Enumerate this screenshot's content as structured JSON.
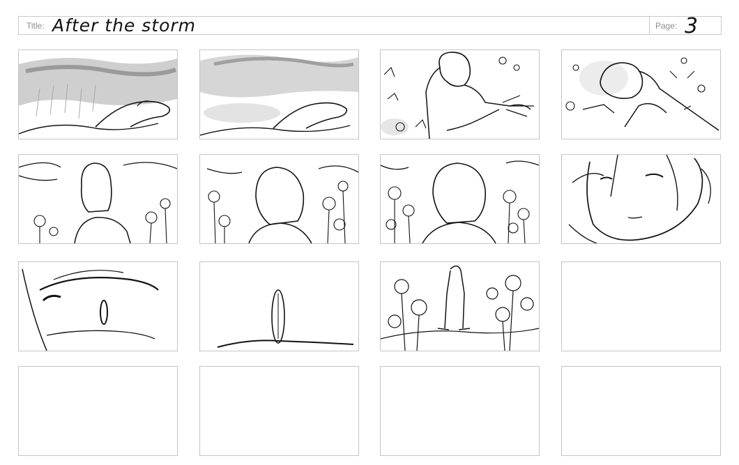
{
  "header": {
    "title_label": "Title:",
    "title_value": "After the storm",
    "page_label": "Page:",
    "page_value": "3"
  },
  "panels": [
    {
      "index": 1,
      "content": "storm-sky-reclining-figure"
    },
    {
      "index": 2,
      "content": "storm-clearing-reclining-figure"
    },
    {
      "index": 3,
      "content": "character-reaching-among-flowers"
    },
    {
      "index": 4,
      "content": "character-lying-flowers-blowing"
    },
    {
      "index": 5,
      "content": "back-view-clouds-flowers"
    },
    {
      "index": 6,
      "content": "side-view-flower-field"
    },
    {
      "index": 7,
      "content": "three-quarter-view-flower-field"
    },
    {
      "index": 8,
      "content": "face-closeup"
    },
    {
      "index": 9,
      "content": "eye-extreme-closeup"
    },
    {
      "index": 10,
      "content": "single-petal-on-ground"
    },
    {
      "index": 11,
      "content": "figure-standing-in-flowers"
    },
    {
      "index": 12,
      "content": "empty"
    },
    {
      "index": 13,
      "content": "empty"
    },
    {
      "index": 14,
      "content": "empty"
    },
    {
      "index": 15,
      "content": "empty"
    },
    {
      "index": 16,
      "content": "empty"
    }
  ]
}
